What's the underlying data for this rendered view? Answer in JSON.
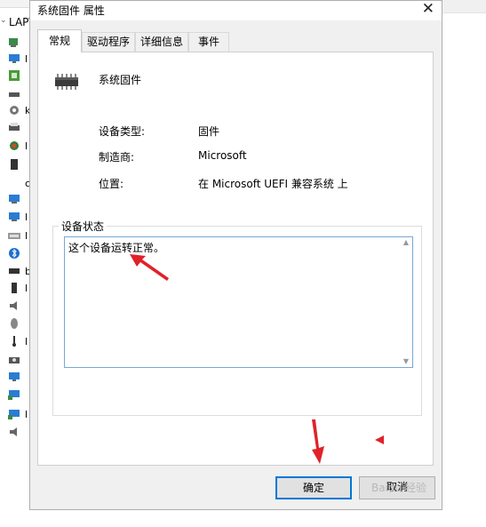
{
  "background": {
    "root_label": "LAPT",
    "tree_truncated_letters": [
      "l",
      "k",
      "l",
      "c",
      "l",
      "l",
      "b",
      "l",
      "l",
      "l"
    ]
  },
  "dialog": {
    "title": "系统固件 属性",
    "close_glyph": "✕",
    "tabs": [
      {
        "label": "常规",
        "active": true
      },
      {
        "label": "驱动程序",
        "active": false
      },
      {
        "label": "详细信息",
        "active": false
      },
      {
        "label": "事件",
        "active": false
      }
    ],
    "device_name": "系统固件",
    "properties": [
      {
        "label": "设备类型:",
        "value": "固件"
      },
      {
        "label": "制造商:",
        "value": "Microsoft"
      },
      {
        "label": "位置:",
        "value": "在 Microsoft UEFI 兼容系统 上"
      }
    ],
    "status_group_label": "设备状态",
    "status_text": "这个设备运转正常。",
    "buttons": {
      "ok": "确定",
      "cancel": "取消"
    }
  },
  "annotation_color": "#e0222a",
  "accent_color": "#0078d7",
  "watermark": "Baidu 经验"
}
